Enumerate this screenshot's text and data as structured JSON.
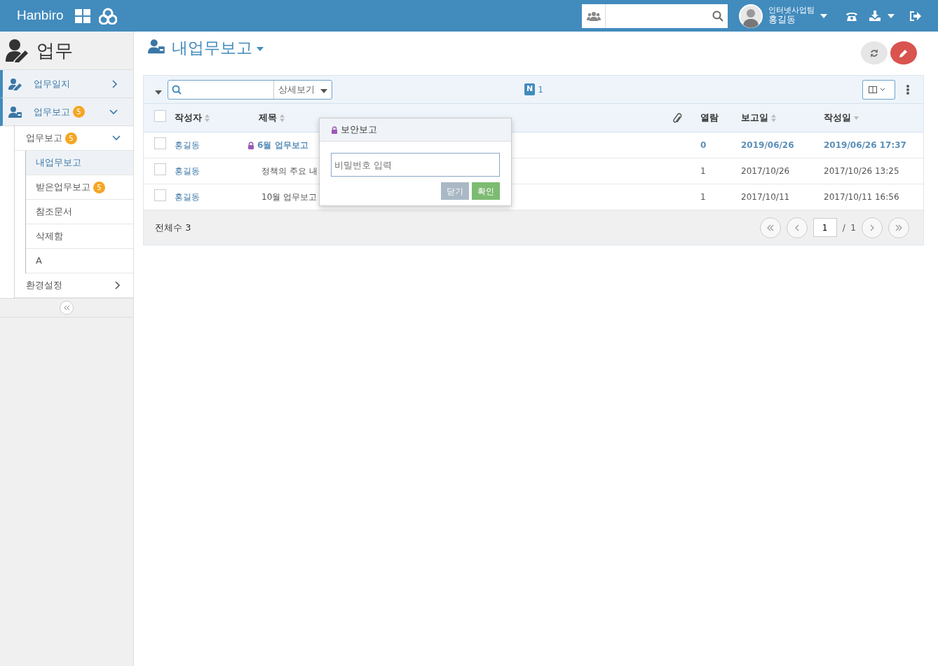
{
  "topbar": {
    "brand": "Hanbiro",
    "user": {
      "team": "인터넷사업팀",
      "name": "홍길동"
    }
  },
  "sidebar": {
    "title": "업무",
    "sections": [
      {
        "label": "업무일지",
        "kind": "log",
        "expanded": false
      },
      {
        "label": "업무보고",
        "kind": "report",
        "badge": "5",
        "expanded": true,
        "children": [
          {
            "label": "업무보고",
            "badge": "5",
            "expanded": true,
            "children": [
              {
                "label": "내업무보고",
                "selected": true
              },
              {
                "label": "받은업무보고",
                "badge": "5",
                "selected": false
              },
              {
                "label": "참조문서",
                "selected": false
              },
              {
                "label": "삭제함",
                "selected": false
              },
              {
                "label": "A",
                "selected": false
              }
            ]
          },
          {
            "label": "환경설정",
            "expanded": false
          }
        ]
      }
    ]
  },
  "page": {
    "title": "내업무보고"
  },
  "toolbar": {
    "view_select": "상세보기",
    "new_badge": "N",
    "new_count": "1"
  },
  "table": {
    "all_checked": false,
    "columns": [
      "작성자",
      "제목",
      "열람",
      "보고일",
      "작성일"
    ],
    "rows": [
      {
        "checked": false,
        "author": "홍길동",
        "title": "6월 업무보고",
        "locked": true,
        "unread": true,
        "views": "0",
        "report_date": "2019/06/26",
        "created": "2019/06/26 17:37"
      },
      {
        "checked": false,
        "author": "홍길동",
        "title": "정책의 주요 내",
        "locked": false,
        "unread": false,
        "views": "1",
        "report_date": "2017/10/26",
        "created": "2017/10/26 13:25"
      },
      {
        "checked": false,
        "author": "홍길동",
        "title": "10월 업무보고",
        "locked": false,
        "unread": false,
        "views": "1",
        "report_date": "2017/10/11",
        "created": "2017/10/11 16:56"
      }
    ],
    "total": "전체수 3",
    "page": "1",
    "pages": "/  1"
  },
  "popover": {
    "title": "보안보고",
    "placeholder": "비밀번호 입력",
    "buttons": [
      "닫기",
      "확인"
    ]
  }
}
